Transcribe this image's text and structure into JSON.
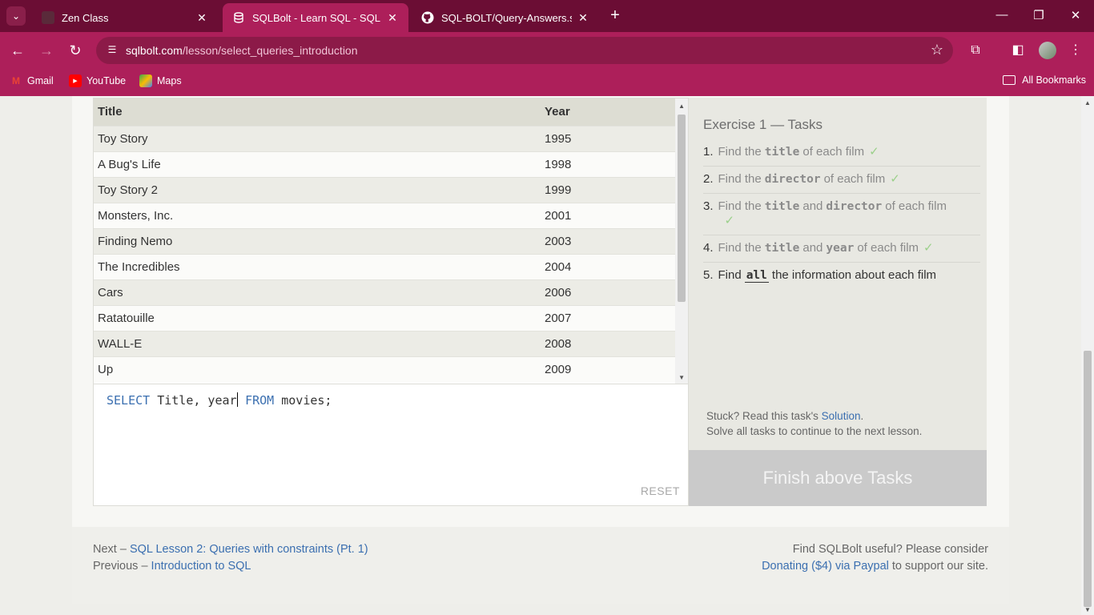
{
  "browser": {
    "tabs": [
      {
        "title": "Zen Class",
        "favicon": "zen-class-icon"
      },
      {
        "title": "SQLBolt - Learn SQL - SQL Lesson",
        "favicon": "database-icon"
      },
      {
        "title": "SQL-BOLT/Query-Answers.sql at",
        "favicon": "github-icon"
      }
    ],
    "url_domain": "sqlbolt.com",
    "url_path": "/lesson/select_queries_introduction",
    "bookmarks": [
      {
        "label": "Gmail",
        "icon": "gmail-icon"
      },
      {
        "label": "YouTube",
        "icon": "youtube-icon"
      },
      {
        "label": "Maps",
        "icon": "maps-icon"
      }
    ],
    "all_bookmarks": "All Bookmarks",
    "colors": {
      "tabbar": "#6b0d34",
      "toolbar": "#ad1f5a"
    }
  },
  "results": {
    "headers": [
      "Title",
      "Year"
    ],
    "rows": [
      [
        "Toy Story",
        "1995"
      ],
      [
        "A Bug's Life",
        "1998"
      ],
      [
        "Toy Story 2",
        "1999"
      ],
      [
        "Monsters, Inc.",
        "2001"
      ],
      [
        "Finding Nemo",
        "2003"
      ],
      [
        "The Incredibles",
        "2004"
      ],
      [
        "Cars",
        "2006"
      ],
      [
        "Ratatouille",
        "2007"
      ],
      [
        "WALL-E",
        "2008"
      ],
      [
        "Up",
        "2009"
      ]
    ]
  },
  "editor": {
    "kw_select": "SELECT",
    "cols": " Title, year",
    "kw_from": "FROM",
    "rest": " movies;",
    "reset": "RESET"
  },
  "tasks": {
    "heading": "Exercise 1 — Tasks",
    "check": "✓",
    "items": [
      {
        "num": "1.",
        "pre": "Find the",
        "code": "title",
        "post": "of each film"
      },
      {
        "num": "2.",
        "pre": "Find the",
        "code": "director",
        "post": "of each film"
      },
      {
        "num": "3.",
        "pre": "Find the",
        "code": "title",
        "mid": "and",
        "code2": "director",
        "post": "of each film"
      },
      {
        "num": "4.",
        "pre": "Find the",
        "code": "title",
        "mid": "and",
        "code2": "year",
        "post": "of each film"
      },
      {
        "num": "5.",
        "pre": "Find",
        "code": "all",
        "post": "the information about each film"
      }
    ],
    "stuck_text": "Stuck? Read this task's",
    "solution_link": "Solution",
    "stuck_end": ".",
    "solve_text": "Solve all tasks to continue to the next lesson.",
    "finish_button": "Finish above Tasks"
  },
  "footer": {
    "next_prefix": "Next –",
    "next_link": "SQL Lesson 2: Queries with constraints (Pt. 1)",
    "prev_prefix": "Previous –",
    "prev_link": "Introduction to SQL",
    "useful_text": "Find SQLBolt useful? Please consider",
    "donate_link": "Donating ($4) via Paypal",
    "support_text": "to support our site."
  }
}
